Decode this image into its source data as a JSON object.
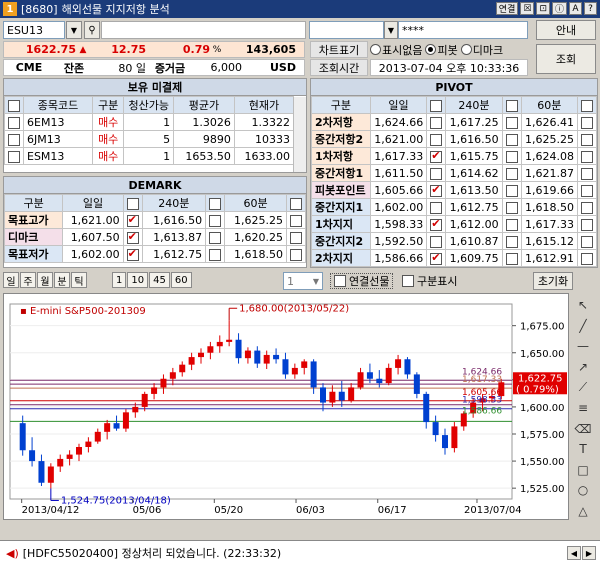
{
  "window": {
    "code": "[8680]",
    "title": "해외선물 지지저항 분석",
    "buttons": [
      "연결",
      "☒",
      "⊡",
      "ⓘ",
      "A",
      "?"
    ]
  },
  "top": {
    "symbol": "ESU13",
    "password": "****",
    "view_button": "안내",
    "query_button": "조회",
    "price": "1622.75",
    "price_arrow": "▲",
    "change": "12.75",
    "change_pct": "0.79",
    "pct_sign": "%",
    "volume": "143,605",
    "exchange": "CME",
    "remain_label": "잔존",
    "remain_value": "80 일",
    "margin_label": "증거금",
    "margin_value": "6,000",
    "currency": "USD",
    "chart_label": "차트표기",
    "options": [
      "표시없음",
      "피봇",
      "디마크"
    ],
    "selected_option": 1,
    "time_label": "조회시간",
    "time_value": "2013-07-04 오후 10:33:36"
  },
  "holdings": {
    "title": "보유 미결제",
    "headers": [
      "종목코드",
      "구분",
      "청산가능",
      "평균가",
      "현재가"
    ],
    "rows": [
      {
        "code": "6EM13",
        "side": "매수",
        "qty": "1",
        "avg": "1.3026",
        "cur": "1.3322"
      },
      {
        "code": "6JM13",
        "side": "매수",
        "qty": "5",
        "avg": "9890",
        "cur": "10333"
      },
      {
        "code": "ESM13",
        "side": "매수",
        "qty": "1",
        "avg": "1653.50",
        "cur": "1633.00"
      }
    ]
  },
  "pivot": {
    "title": "PIVOT",
    "headers": [
      "구분",
      "일일",
      "240분",
      "60분"
    ],
    "rows": [
      {
        "label": "2차저항",
        "cls": "lbl-orange",
        "d": "1,624.66",
        "m240": "1,617.25",
        "m60": "1,626.41",
        "cd": false,
        "c240": false,
        "c60": false
      },
      {
        "label": "중간저항2",
        "cls": "lbl-orange",
        "d": "1,621.00",
        "m240": "1,616.50",
        "m60": "1,625.25",
        "cd": false,
        "c240": false,
        "c60": false
      },
      {
        "label": "1차저항",
        "cls": "lbl-orange",
        "d": "1,617.33",
        "m240": "1,615.75",
        "m60": "1,624.08",
        "cd": true,
        "c240": false,
        "c60": false
      },
      {
        "label": "중간저항1",
        "cls": "lbl-orange",
        "d": "1,611.50",
        "m240": "1,614.62",
        "m60": "1,621.87",
        "cd": false,
        "c240": false,
        "c60": false
      },
      {
        "label": "피봇포인트",
        "cls": "lbl-pink",
        "d": "1,605.66",
        "m240": "1,613.50",
        "m60": "1,619.66",
        "cd": true,
        "c240": false,
        "c60": false
      },
      {
        "label": "중간지지1",
        "cls": "lbl-blue",
        "d": "1,602.00",
        "m240": "1,612.75",
        "m60": "1,618.50",
        "cd": false,
        "c240": false,
        "c60": false
      },
      {
        "label": "1차지지",
        "cls": "lbl-blue",
        "d": "1,598.33",
        "m240": "1,612.00",
        "m60": "1,617.33",
        "cd": true,
        "c240": false,
        "c60": false
      },
      {
        "label": "중간지지2",
        "cls": "lbl-blue",
        "d": "1,592.50",
        "m240": "1,610.87",
        "m60": "1,615.12",
        "cd": false,
        "c240": false,
        "c60": false
      },
      {
        "label": "2차지지",
        "cls": "lbl-blue",
        "d": "1,586.66",
        "m240": "1,609.75",
        "m60": "1,612.91",
        "cd": true,
        "c240": false,
        "c60": false
      }
    ]
  },
  "demark": {
    "title": "DEMARK",
    "headers": [
      "구분",
      "일일",
      "240분",
      "60분"
    ],
    "rows": [
      {
        "label": "목표고가",
        "cls": "lbl-orange",
        "d": "1,621.00",
        "m240": "1,616.50",
        "m60": "1,625.25",
        "cd": true,
        "c240": false,
        "c60": false
      },
      {
        "label": "디마크",
        "cls": "lbl-pink",
        "d": "1,607.50",
        "m240": "1,613.87",
        "m60": "1,620.25",
        "cd": true,
        "c240": false,
        "c60": false
      },
      {
        "label": "목표저가",
        "cls": "lbl-blue",
        "d": "1,602.00",
        "m240": "1,612.75",
        "m60": "1,618.50",
        "cd": true,
        "c240": false,
        "c60": false
      }
    ]
  },
  "periods": [
    "일",
    "주",
    "월",
    "분",
    "틱"
  ],
  "intervals": [
    "1",
    "10",
    "45",
    "60"
  ],
  "spinner": "1",
  "continuous_label": "연결선물",
  "divider_label": "구분표시",
  "reset_label": "초기화",
  "status_text": "[HDFC55020400] 정상처리 되었습니다. (22:33:32)",
  "chart_data": {
    "type": "candlestick",
    "series_name": "E-mini S&P500-201309",
    "ylim": [
      1515,
      1695
    ],
    "yticks": [
      "1,525.00",
      "1,550.00",
      "1,575.00",
      "1,600.00",
      "1,625.00",
      "1,650.00",
      "1,675.00"
    ],
    "xticks": [
      "2013/04/12",
      "05/06",
      "05/20",
      "06/03",
      "06/17",
      "2013/07/04"
    ],
    "max_annotation": "1,680.00(2013/05/22)",
    "min_annotation": "1,524.75(2013/04/18)",
    "right_labels": [
      "1,624.66",
      "1,617.33",
      "1,605.66",
      "1,598.33",
      "1,586.66"
    ],
    "current_price": "1,622.75",
    "current_pct": "( 0.79%)",
    "levels": [
      {
        "value": 1624.66,
        "color": "#7a2a6a"
      },
      {
        "value": 1621.0,
        "color": "#7a2a6a"
      },
      {
        "value": 1617.33,
        "color": "#c07050"
      },
      {
        "value": 1605.66,
        "color": "#d00000"
      },
      {
        "value": 1602.0,
        "color": "#7a2a6a"
      },
      {
        "value": 1598.33,
        "color": "#2b2bb0"
      },
      {
        "value": 1586.66,
        "color": "#2f8f2f"
      }
    ],
    "candles": [
      [
        1585,
        1592,
        1555,
        1560
      ],
      [
        1560,
        1572,
        1545,
        1550
      ],
      [
        1550,
        1556,
        1527,
        1530
      ],
      [
        1530,
        1548,
        1524.75,
        1545
      ],
      [
        1545,
        1556,
        1540,
        1552
      ],
      [
        1552,
        1560,
        1546,
        1556
      ],
      [
        1556,
        1566,
        1550,
        1563
      ],
      [
        1563,
        1572,
        1558,
        1568
      ],
      [
        1568,
        1580,
        1566,
        1577
      ],
      [
        1577,
        1588,
        1570,
        1585
      ],
      [
        1585,
        1592,
        1578,
        1580
      ],
      [
        1580,
        1598,
        1577,
        1595
      ],
      [
        1595,
        1604,
        1590,
        1600
      ],
      [
        1600,
        1614,
        1596,
        1612
      ],
      [
        1612,
        1622,
        1607,
        1618
      ],
      [
        1618,
        1630,
        1612,
        1626
      ],
      [
        1626,
        1636,
        1620,
        1632
      ],
      [
        1632,
        1642,
        1628,
        1639
      ],
      [
        1639,
        1650,
        1634,
        1646
      ],
      [
        1646,
        1654,
        1640,
        1650
      ],
      [
        1650,
        1660,
        1644,
        1656
      ],
      [
        1656,
        1666,
        1650,
        1660
      ],
      [
        1660,
        1680,
        1656,
        1662
      ],
      [
        1662,
        1668,
        1640,
        1645
      ],
      [
        1645,
        1655,
        1640,
        1652
      ],
      [
        1652,
        1656,
        1636,
        1640
      ],
      [
        1640,
        1652,
        1635,
        1648
      ],
      [
        1648,
        1654,
        1640,
        1644
      ],
      [
        1644,
        1650,
        1626,
        1630
      ],
      [
        1630,
        1640,
        1626,
        1636
      ],
      [
        1636,
        1644,
        1630,
        1642
      ],
      [
        1642,
        1644,
        1612,
        1618
      ],
      [
        1618,
        1622,
        1596,
        1604
      ],
      [
        1604,
        1620,
        1600,
        1614
      ],
      [
        1614,
        1624,
        1600,
        1606
      ],
      [
        1606,
        1622,
        1604,
        1618
      ],
      [
        1618,
        1636,
        1616,
        1632
      ],
      [
        1632,
        1640,
        1622,
        1626
      ],
      [
        1626,
        1634,
        1618,
        1622
      ],
      [
        1622,
        1640,
        1620,
        1636
      ],
      [
        1636,
        1648,
        1630,
        1644
      ],
      [
        1644,
        1646,
        1626,
        1630
      ],
      [
        1630,
        1632,
        1608,
        1612
      ],
      [
        1612,
        1614,
        1580,
        1586
      ],
      [
        1586,
        1592,
        1568,
        1574
      ],
      [
        1574,
        1580,
        1556,
        1562
      ],
      [
        1562,
        1586,
        1558,
        1582
      ],
      [
        1582,
        1596,
        1578,
        1594
      ],
      [
        1594,
        1608,
        1590,
        1604
      ],
      [
        1604,
        1612,
        1596,
        1608
      ],
      [
        1608,
        1616,
        1604,
        1610
      ],
      [
        1610,
        1626,
        1607,
        1622.75
      ]
    ]
  }
}
